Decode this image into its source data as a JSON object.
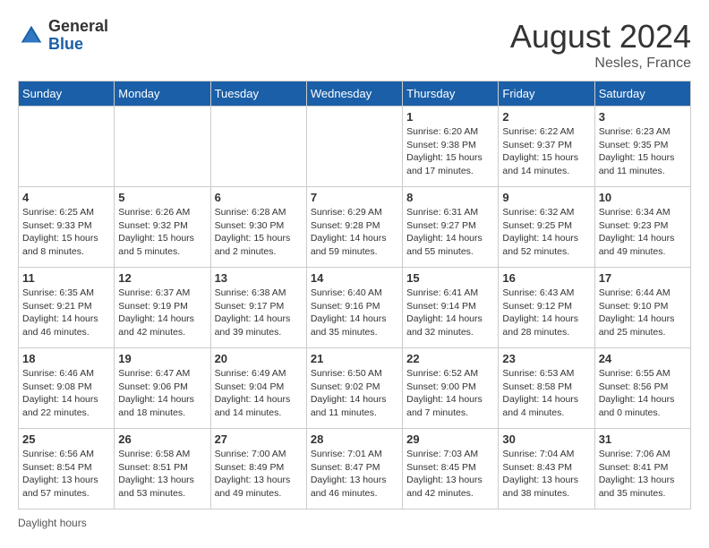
{
  "header": {
    "logo_general": "General",
    "logo_blue": "Blue",
    "month_title": "August 2024",
    "location": "Nesles, France"
  },
  "weekdays": [
    "Sunday",
    "Monday",
    "Tuesday",
    "Wednesday",
    "Thursday",
    "Friday",
    "Saturday"
  ],
  "weeks": [
    [
      {
        "day": "",
        "info": ""
      },
      {
        "day": "",
        "info": ""
      },
      {
        "day": "",
        "info": ""
      },
      {
        "day": "",
        "info": ""
      },
      {
        "day": "1",
        "info": "Sunrise: 6:20 AM\nSunset: 9:38 PM\nDaylight: 15 hours\nand 17 minutes."
      },
      {
        "day": "2",
        "info": "Sunrise: 6:22 AM\nSunset: 9:37 PM\nDaylight: 15 hours\nand 14 minutes."
      },
      {
        "day": "3",
        "info": "Sunrise: 6:23 AM\nSunset: 9:35 PM\nDaylight: 15 hours\nand 11 minutes."
      }
    ],
    [
      {
        "day": "4",
        "info": "Sunrise: 6:25 AM\nSunset: 9:33 PM\nDaylight: 15 hours\nand 8 minutes."
      },
      {
        "day": "5",
        "info": "Sunrise: 6:26 AM\nSunset: 9:32 PM\nDaylight: 15 hours\nand 5 minutes."
      },
      {
        "day": "6",
        "info": "Sunrise: 6:28 AM\nSunset: 9:30 PM\nDaylight: 15 hours\nand 2 minutes."
      },
      {
        "day": "7",
        "info": "Sunrise: 6:29 AM\nSunset: 9:28 PM\nDaylight: 14 hours\nand 59 minutes."
      },
      {
        "day": "8",
        "info": "Sunrise: 6:31 AM\nSunset: 9:27 PM\nDaylight: 14 hours\nand 55 minutes."
      },
      {
        "day": "9",
        "info": "Sunrise: 6:32 AM\nSunset: 9:25 PM\nDaylight: 14 hours\nand 52 minutes."
      },
      {
        "day": "10",
        "info": "Sunrise: 6:34 AM\nSunset: 9:23 PM\nDaylight: 14 hours\nand 49 minutes."
      }
    ],
    [
      {
        "day": "11",
        "info": "Sunrise: 6:35 AM\nSunset: 9:21 PM\nDaylight: 14 hours\nand 46 minutes."
      },
      {
        "day": "12",
        "info": "Sunrise: 6:37 AM\nSunset: 9:19 PM\nDaylight: 14 hours\nand 42 minutes."
      },
      {
        "day": "13",
        "info": "Sunrise: 6:38 AM\nSunset: 9:17 PM\nDaylight: 14 hours\nand 39 minutes."
      },
      {
        "day": "14",
        "info": "Sunrise: 6:40 AM\nSunset: 9:16 PM\nDaylight: 14 hours\nand 35 minutes."
      },
      {
        "day": "15",
        "info": "Sunrise: 6:41 AM\nSunset: 9:14 PM\nDaylight: 14 hours\nand 32 minutes."
      },
      {
        "day": "16",
        "info": "Sunrise: 6:43 AM\nSunset: 9:12 PM\nDaylight: 14 hours\nand 28 minutes."
      },
      {
        "day": "17",
        "info": "Sunrise: 6:44 AM\nSunset: 9:10 PM\nDaylight: 14 hours\nand 25 minutes."
      }
    ],
    [
      {
        "day": "18",
        "info": "Sunrise: 6:46 AM\nSunset: 9:08 PM\nDaylight: 14 hours\nand 22 minutes."
      },
      {
        "day": "19",
        "info": "Sunrise: 6:47 AM\nSunset: 9:06 PM\nDaylight: 14 hours\nand 18 minutes."
      },
      {
        "day": "20",
        "info": "Sunrise: 6:49 AM\nSunset: 9:04 PM\nDaylight: 14 hours\nand 14 minutes."
      },
      {
        "day": "21",
        "info": "Sunrise: 6:50 AM\nSunset: 9:02 PM\nDaylight: 14 hours\nand 11 minutes."
      },
      {
        "day": "22",
        "info": "Sunrise: 6:52 AM\nSunset: 9:00 PM\nDaylight: 14 hours\nand 7 minutes."
      },
      {
        "day": "23",
        "info": "Sunrise: 6:53 AM\nSunset: 8:58 PM\nDaylight: 14 hours\nand 4 minutes."
      },
      {
        "day": "24",
        "info": "Sunrise: 6:55 AM\nSunset: 8:56 PM\nDaylight: 14 hours\nand 0 minutes."
      }
    ],
    [
      {
        "day": "25",
        "info": "Sunrise: 6:56 AM\nSunset: 8:54 PM\nDaylight: 13 hours\nand 57 minutes."
      },
      {
        "day": "26",
        "info": "Sunrise: 6:58 AM\nSunset: 8:51 PM\nDaylight: 13 hours\nand 53 minutes."
      },
      {
        "day": "27",
        "info": "Sunrise: 7:00 AM\nSunset: 8:49 PM\nDaylight: 13 hours\nand 49 minutes."
      },
      {
        "day": "28",
        "info": "Sunrise: 7:01 AM\nSunset: 8:47 PM\nDaylight: 13 hours\nand 46 minutes."
      },
      {
        "day": "29",
        "info": "Sunrise: 7:03 AM\nSunset: 8:45 PM\nDaylight: 13 hours\nand 42 minutes."
      },
      {
        "day": "30",
        "info": "Sunrise: 7:04 AM\nSunset: 8:43 PM\nDaylight: 13 hours\nand 38 minutes."
      },
      {
        "day": "31",
        "info": "Sunrise: 7:06 AM\nSunset: 8:41 PM\nDaylight: 13 hours\nand 35 minutes."
      }
    ]
  ],
  "footer": {
    "note": "Daylight hours"
  }
}
